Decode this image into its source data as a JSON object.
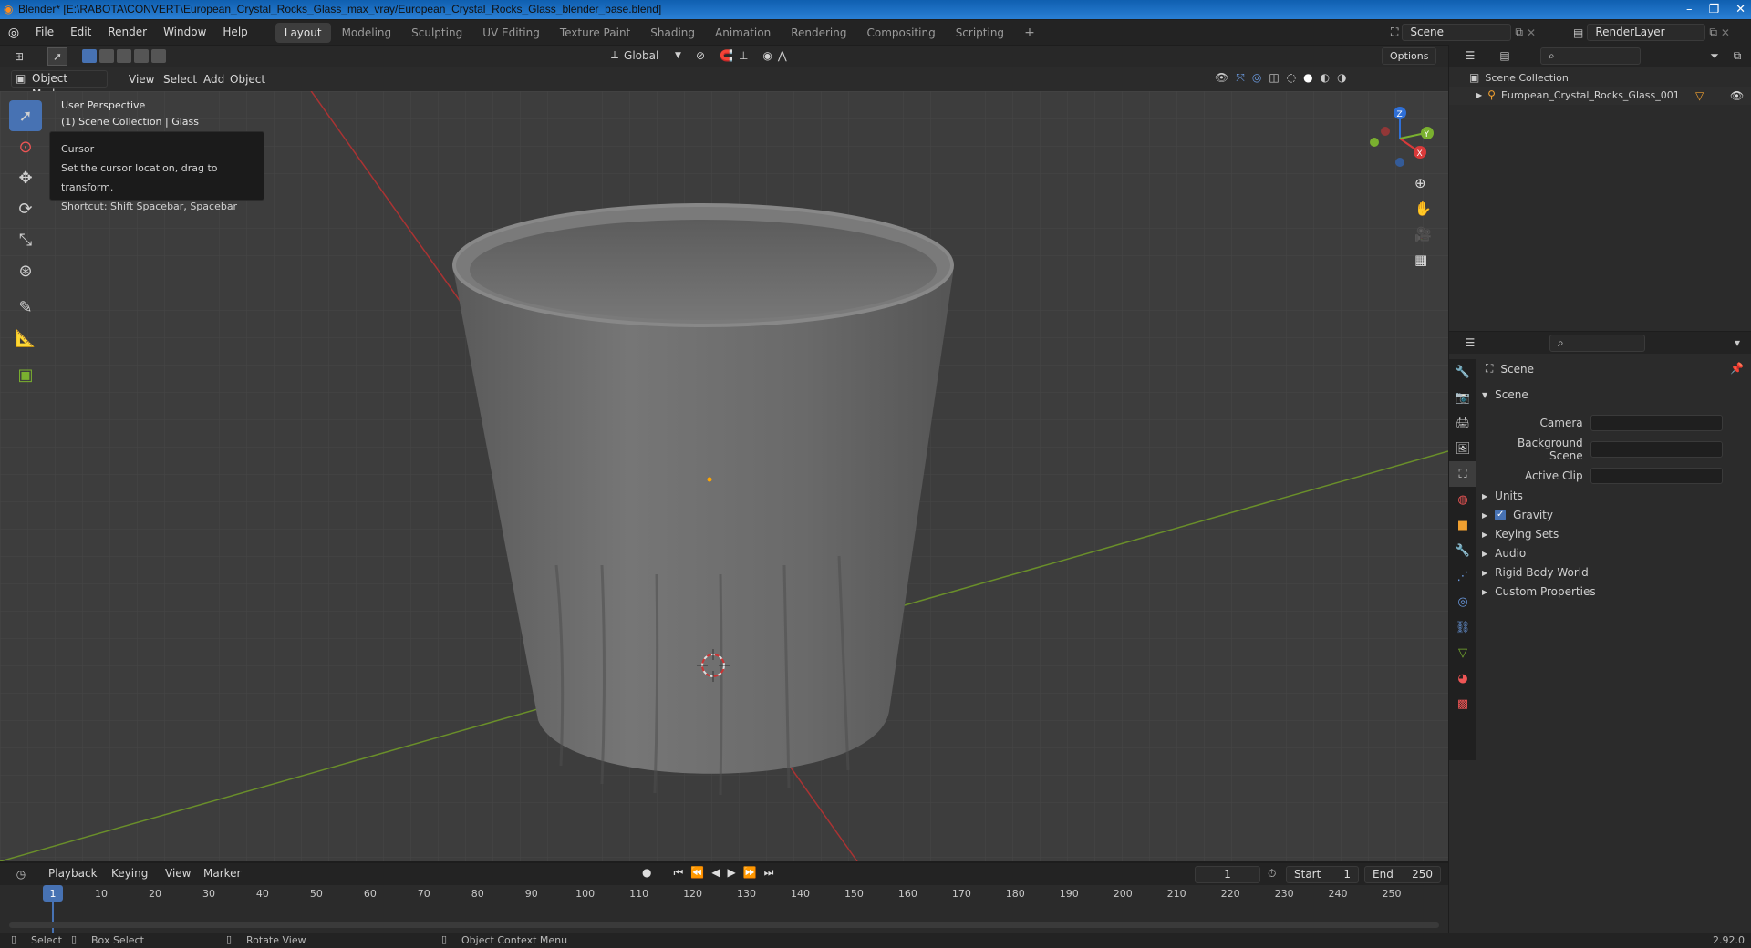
{
  "window": {
    "title": "Blender* [E:\\RABOTA\\CONVERT\\European_Crystal_Rocks_Glass_max_vray/European_Crystal_Rocks_Glass_blender_base.blend]",
    "controls": [
      "–",
      "❐",
      "✕"
    ]
  },
  "menu": [
    "File",
    "Edit",
    "Render",
    "Window",
    "Help"
  ],
  "workspaces": [
    "Layout",
    "Modeling",
    "Sculpting",
    "UV Editing",
    "Texture Paint",
    "Shading",
    "Animation",
    "Rendering",
    "Compositing",
    "Scripting"
  ],
  "active_workspace": "Layout",
  "scene_field": "Scene",
  "renderlayer_field": "RenderLayer",
  "header": {
    "transform_orientation": "Global",
    "options_label": "Options",
    "mode": "Object Mode",
    "menus": [
      "View",
      "Select",
      "Add",
      "Object"
    ]
  },
  "viewport": {
    "view_name": "User Perspective",
    "collection_info": "(1) Scene Collection | Glass",
    "axes": {
      "x": "X",
      "y": "Y",
      "z": "Z"
    }
  },
  "tooltip": {
    "title": "Cursor",
    "description": "Set the cursor location, drag to transform.",
    "shortcut": "Shortcut: Shift Spacebar, Spacebar"
  },
  "outliner": {
    "root": "Scene Collection",
    "items": [
      "European_Crystal_Rocks_Glass_001"
    ]
  },
  "properties": {
    "context": "Scene",
    "section": "Scene",
    "fields": [
      {
        "label": "Camera",
        "value": ""
      },
      {
        "label": "Background Scene",
        "value": ""
      },
      {
        "label": "Active Clip",
        "value": ""
      }
    ],
    "subpanels": [
      "Units",
      "Gravity",
      "Keying Sets",
      "Audio",
      "Rigid Body World",
      "Custom Properties"
    ],
    "gravity_checked": true
  },
  "timeline": {
    "menus": [
      "Playback",
      "Keying",
      "View",
      "Marker"
    ],
    "current_frame": "1",
    "start_label": "Start",
    "start": "1",
    "end_label": "End",
    "end": "250",
    "ruler": [
      "1",
      "10",
      "20",
      "30",
      "40",
      "50",
      "60",
      "70",
      "80",
      "90",
      "100",
      "110",
      "120",
      "130",
      "140",
      "150",
      "160",
      "170",
      "180",
      "190",
      "200",
      "210",
      "220",
      "230",
      "240",
      "250"
    ]
  },
  "statusbar": {
    "select": "Select",
    "box_select": "Box Select",
    "rotate_view": "Rotate View",
    "context_menu": "Object Context Menu",
    "version": "2.92.0"
  },
  "colors": {
    "accent": "#4772b3",
    "viewport_bg": "#3d3d3d",
    "x_axis": "#d93a3a",
    "y_axis": "#7ab02f",
    "z_axis": "#2f6fd6"
  }
}
